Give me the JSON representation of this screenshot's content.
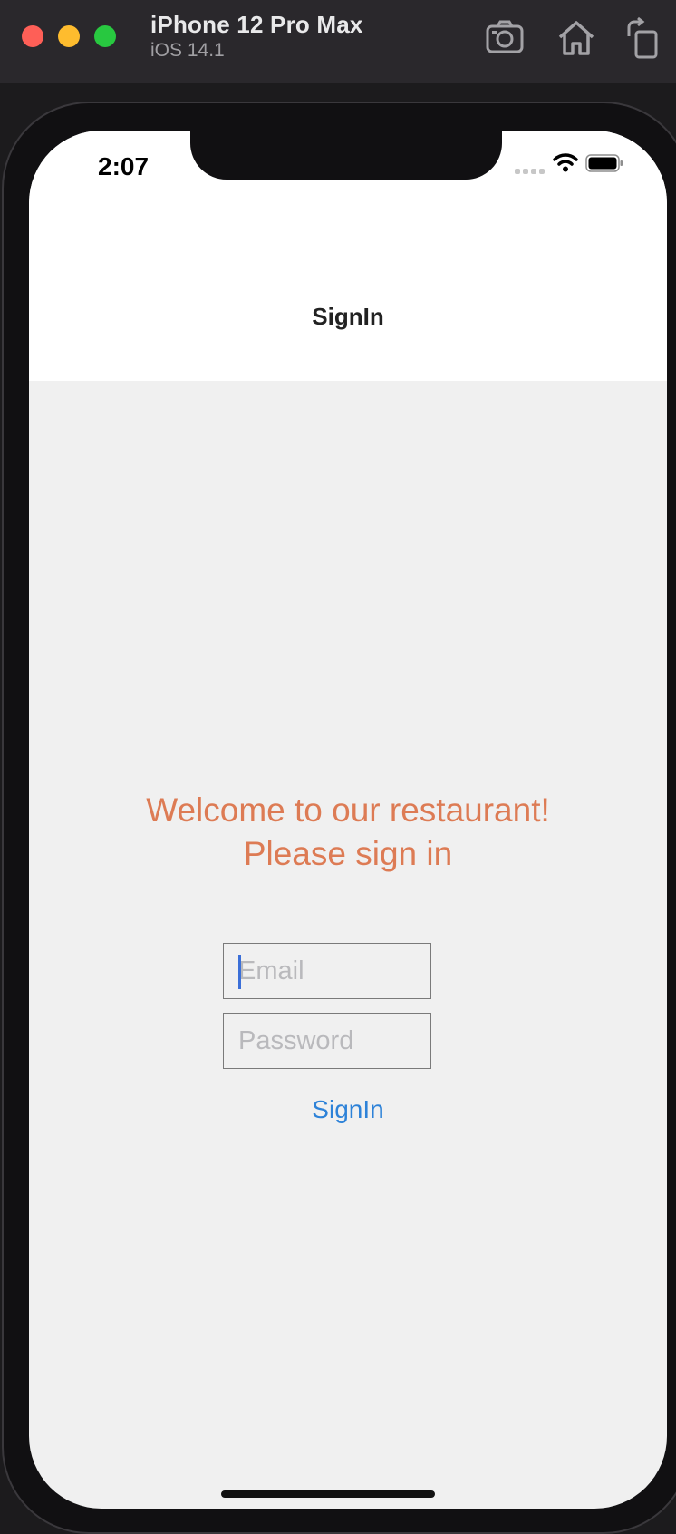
{
  "simulator": {
    "device_name": "iPhone 12 Pro Max",
    "os_version": "iOS 14.1",
    "toolbar_icons": [
      "screenshot-icon",
      "home-icon",
      "rotate-icon"
    ]
  },
  "status_bar": {
    "time": "2:07",
    "icons": [
      "cellular-signal-icon",
      "wifi-icon",
      "battery-icon"
    ]
  },
  "nav": {
    "title": "SignIn"
  },
  "main": {
    "welcome_line1": "Welcome to our restaurant!",
    "welcome_line2": "Please sign in",
    "email": {
      "placeholder": "Email",
      "value": ""
    },
    "password": {
      "placeholder": "Password",
      "value": ""
    },
    "signin_label": "SignIn"
  },
  "colors": {
    "welcome_text": "#dd7b54",
    "link_blue": "#2d82d8",
    "background": "#f0f0f0"
  }
}
